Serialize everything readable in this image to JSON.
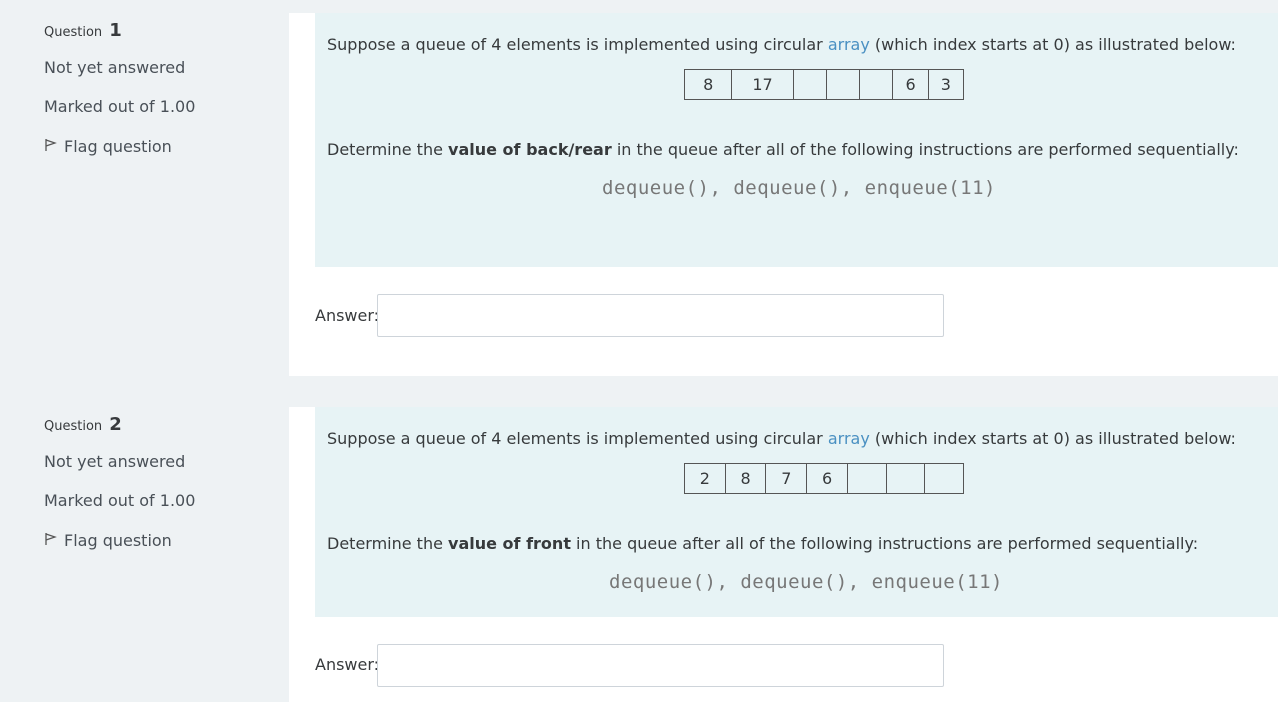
{
  "questions": [
    {
      "label": "Question",
      "number": "1",
      "status": "Not yet answered",
      "marks": "Marked out of 1.00",
      "flag": "Flag question",
      "intro_before": "Suppose a queue of 4 elements is implemented using circular ",
      "intro_link": "array",
      "intro_after": " (which index starts at 0) as illustrated below:",
      "cells": [
        "8",
        "17",
        "",
        "",
        "",
        "6",
        "3"
      ],
      "task_before": "Determine the ",
      "task_bold": "value of back/rear",
      "task_after": " in the queue after all of the following instructions are performed sequentially:",
      "code": "dequeue(), dequeue(), enqueue(11)",
      "answer_label": "Answer:",
      "answer_value": ""
    },
    {
      "label": "Question",
      "number": "2",
      "status": "Not yet answered",
      "marks": "Marked out of 1.00",
      "flag": "Flag question",
      "intro_before": "Suppose a queue of 4 elements is implemented using circular ",
      "intro_link": "array",
      "intro_after": " (which index starts at 0) as illustrated below:",
      "cells": [
        "2",
        "8",
        "7",
        "6",
        "",
        "",
        ""
      ],
      "task_before": "Determine the ",
      "task_bold": "value of front",
      "task_after": " in the queue after all of the following instructions are performed sequentially:",
      "code": "dequeue(), dequeue(), enqueue(11)",
      "answer_label": "Answer:",
      "answer_value": ""
    }
  ],
  "icons": {
    "flag": "flag-icon"
  }
}
